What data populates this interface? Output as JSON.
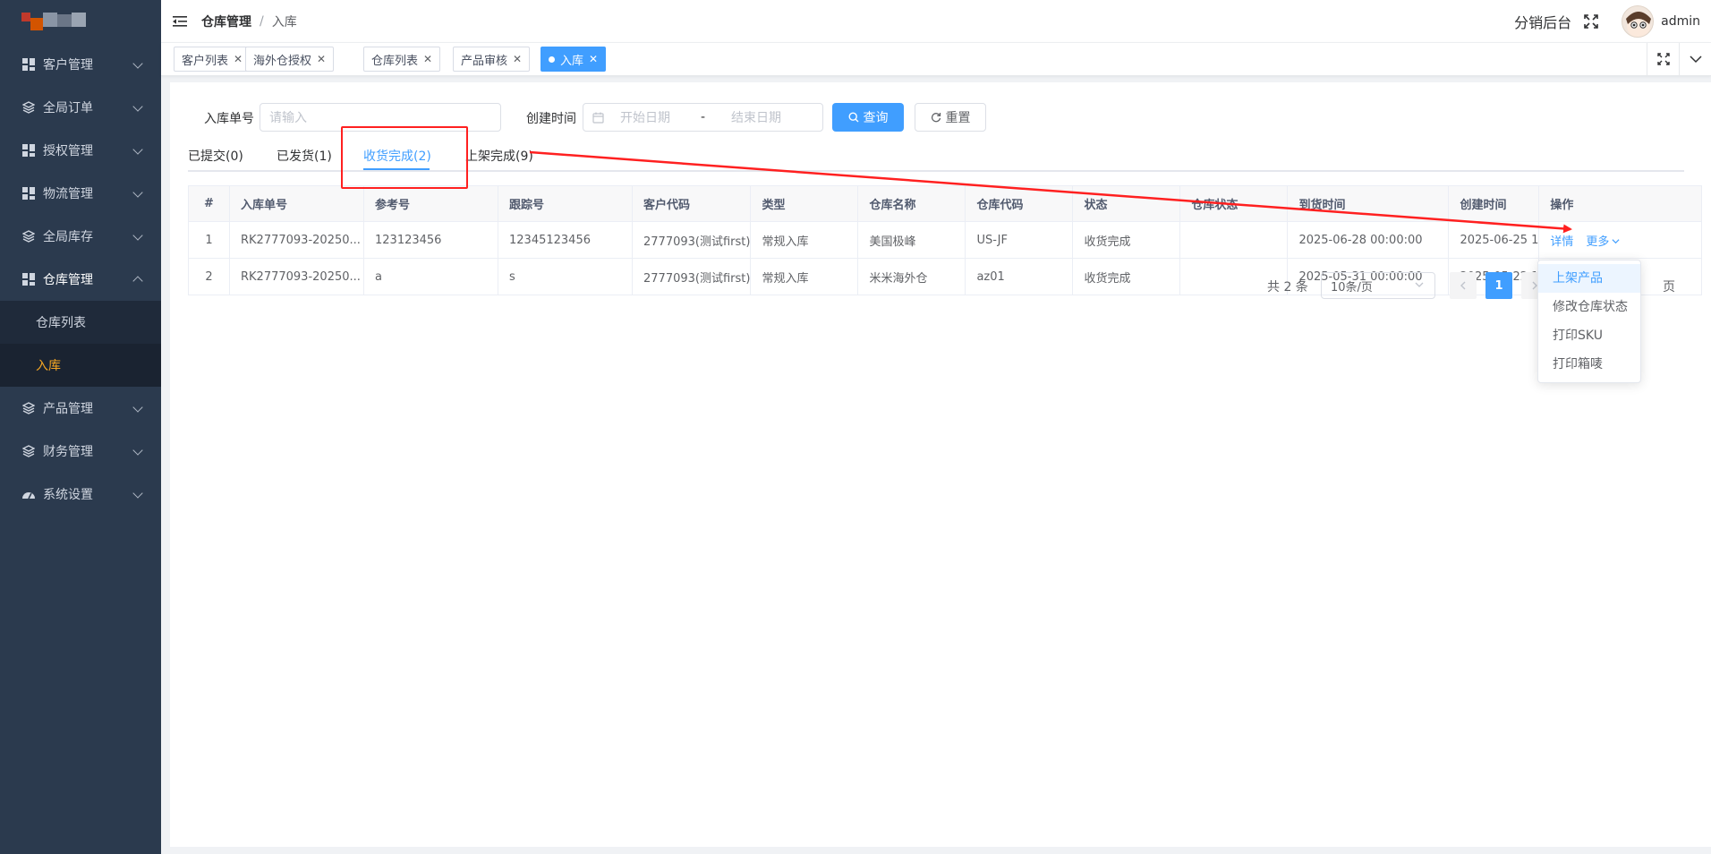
{
  "sidebar": {
    "items": [
      {
        "label": "客户管理",
        "icon": "grid-icon"
      },
      {
        "label": "全局订单",
        "icon": "layers-icon"
      },
      {
        "label": "授权管理",
        "icon": "grid-icon"
      },
      {
        "label": "物流管理",
        "icon": "grid-icon"
      },
      {
        "label": "全局库存",
        "icon": "layers-icon"
      },
      {
        "label": "仓库管理",
        "icon": "grid-icon",
        "open": true
      },
      {
        "label": "产品管理",
        "icon": "layers-icon"
      },
      {
        "label": "财务管理",
        "icon": "layers-icon"
      },
      {
        "label": "系统设置",
        "icon": "dashboard-icon"
      }
    ],
    "submenu": [
      {
        "label": "仓库列表"
      },
      {
        "label": "入库",
        "active": true
      }
    ]
  },
  "header": {
    "breadcrumb_main": "仓库管理",
    "breadcrumb_sep": "/",
    "breadcrumb_current": "入库",
    "distribution": "分销后台",
    "username": "admin"
  },
  "tags": [
    {
      "label": "客户列表"
    },
    {
      "label": "海外仓授权"
    },
    {
      "label": "仓库列表"
    },
    {
      "label": "产品审核"
    },
    {
      "label": "入库",
      "active": true
    }
  ],
  "search": {
    "order_label": "入库单号",
    "order_placeholder": "请输入",
    "date_label": "创建时间",
    "start_placeholder": "开始日期",
    "date_sep": "-",
    "end_placeholder": "结束日期",
    "query_label": "查询",
    "reset_label": "重置"
  },
  "tabs": [
    {
      "label": "已提交(0)"
    },
    {
      "label": "已发货(1)"
    },
    {
      "label": "收货完成(2)",
      "active": true
    },
    {
      "label": "上架完成(9)"
    }
  ],
  "table": {
    "headers": [
      "#",
      "入库单号",
      "参考号",
      "跟踪号",
      "客户代码",
      "类型",
      "仓库名称",
      "仓库代码",
      "状态",
      "仓库状态",
      "到货时间",
      "创建时间",
      "操作"
    ],
    "rows": [
      [
        "1",
        "RK2777093-20250...",
        "123123456",
        "12345123456",
        "2777093(测试first)",
        "常规入库",
        "美国极峰",
        "US-JF",
        "收货完成",
        "",
        "2025-06-28 00:00:00",
        "2025-06-25 1"
      ],
      [
        "2",
        "RK2777093-20250...",
        "a",
        "s",
        "2777093(测试first)",
        "常规入库",
        "米米海外仓",
        "az01",
        "收货完成",
        "",
        "2025-05-31 00:00:00",
        "2025-05-22 1"
      ]
    ],
    "op_detail": "详情",
    "op_more": "更多"
  },
  "dropdown": [
    "上架产品",
    "修改仓库状态",
    "打印SKU",
    "打印箱唛"
  ],
  "pager": {
    "total": "共 2 条",
    "size": "10条/页",
    "current": "1",
    "page_suffix": "页"
  },
  "colors": {
    "primary": "#409eff",
    "sidebar_bg": "#2b3a4e",
    "success": "#67c23a",
    "active_menu": "#f5a623",
    "annotation": "#ff2020"
  }
}
